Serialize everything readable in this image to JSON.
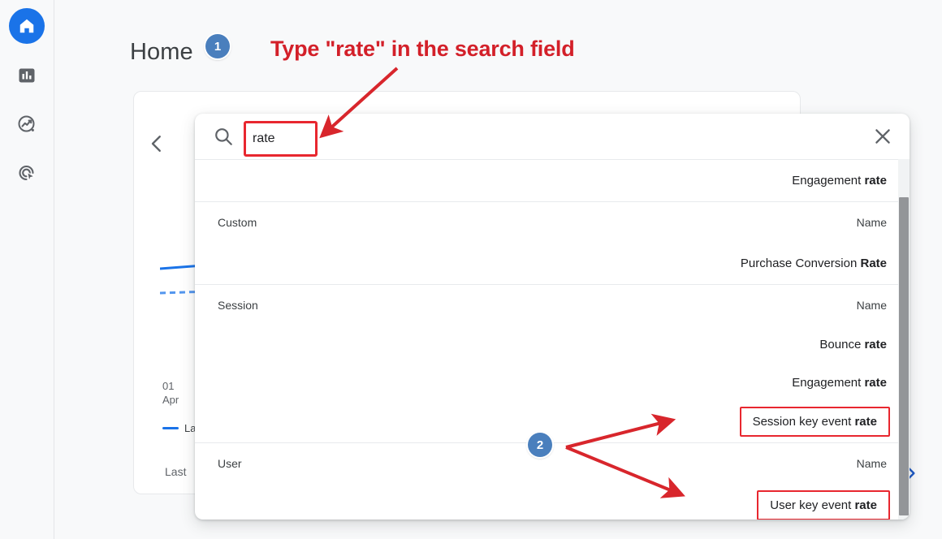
{
  "sidebar": {
    "items": [
      {
        "name": "home-icon",
        "label": "Home",
        "active": true
      },
      {
        "name": "reports-icon",
        "label": "Reports",
        "active": false
      },
      {
        "name": "explore-icon",
        "label": "Explore",
        "active": false
      },
      {
        "name": "advertising-icon",
        "label": "Advertising",
        "active": false
      }
    ]
  },
  "header": {
    "title": "Home",
    "badge_1": "1",
    "annotation": "Type \"rate\" in the search field"
  },
  "annotations": {
    "badge_2": "2",
    "accent_color": "#e8272f",
    "badge_color": "#4a7fbd"
  },
  "chart_card": {
    "back_label": "‹",
    "forward_label": "›",
    "x_tick_day": "01",
    "x_tick_month": "Apr",
    "legend_label": "La",
    "footer_note": "Last"
  },
  "search": {
    "value": "rate",
    "placeholder": "Search",
    "icon": "search-icon",
    "close_icon": "close-icon"
  },
  "results": [
    {
      "type": "item",
      "prefix": "Engagement ",
      "bold": "rate",
      "highlight": false
    },
    {
      "type": "section",
      "label": "Custom",
      "column": "Name"
    },
    {
      "type": "item",
      "prefix": "Purchase Conversion ",
      "bold": "Rate",
      "highlight": false
    },
    {
      "type": "section",
      "label": "Session",
      "column": "Name"
    },
    {
      "type": "item",
      "prefix": "Bounce ",
      "bold": "rate",
      "highlight": false
    },
    {
      "type": "item",
      "prefix": "Engagement ",
      "bold": "rate",
      "highlight": false
    },
    {
      "type": "item",
      "prefix": "Session key event ",
      "bold": "rate",
      "highlight": true
    },
    {
      "type": "section",
      "label": "User",
      "column": "Name"
    },
    {
      "type": "item",
      "prefix": "User key event ",
      "bold": "rate",
      "highlight": true
    }
  ]
}
